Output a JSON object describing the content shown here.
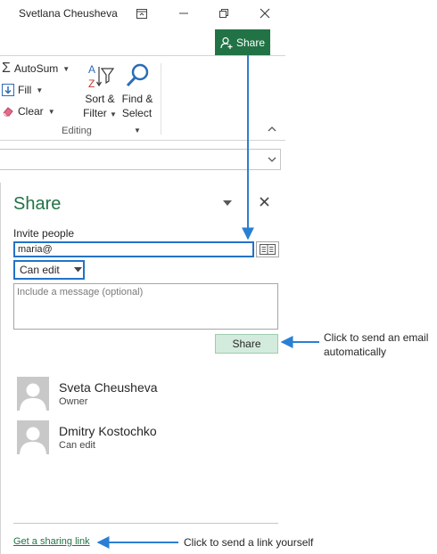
{
  "window": {
    "user_name": "Svetlana Cheusheva"
  },
  "toolbar": {
    "share_label": "Share"
  },
  "ribbon": {
    "autosum_label": "AutoSum",
    "fill_label": "Fill",
    "clear_label": "Clear",
    "sort_line1": "Sort &",
    "sort_line2": "Filter",
    "find_line1": "Find &",
    "find_line2": "Select",
    "group_label": "Editing"
  },
  "share_pane": {
    "title": "Share",
    "invite_label": "Invite people",
    "invite_value": "maria@",
    "permission_value": "Can edit",
    "message_placeholder": "Include a message (optional)",
    "share_button_label": "Share",
    "people": [
      {
        "name": "Sveta Cheusheva",
        "role": "Owner"
      },
      {
        "name": "Dmitry Kostochko",
        "role": "Can edit"
      }
    ],
    "sharing_link_label": "Get a sharing link"
  },
  "annotations": {
    "email_note": "Click to send an email automatically",
    "link_note": "Click to send a link yourself"
  },
  "colors": {
    "accent_green": "#217346",
    "focus_blue": "#2472c8",
    "share_button_bg": "#d3ebdc",
    "annotation_arrow": "#2a7fd4"
  }
}
